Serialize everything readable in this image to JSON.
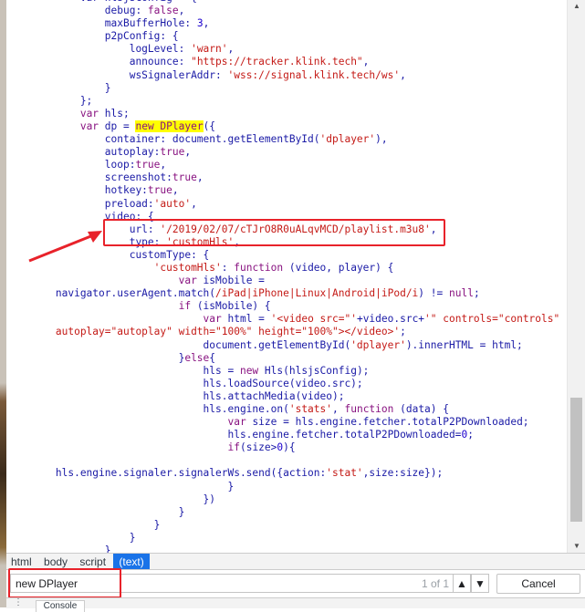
{
  "source_lines": [
    {
      "segs": [
        {
          "t": "            var hlsjsConfig = {",
          "c": "t"
        }
      ]
    },
    {
      "segs": [
        {
          "t": "                debug: ",
          "c": "t"
        },
        {
          "t": "false",
          "c": "kw"
        },
        {
          "t": ",",
          "c": "t"
        }
      ]
    },
    {
      "segs": [
        {
          "t": "                maxBufferHole: ",
          "c": "t"
        },
        {
          "t": "3",
          "c": "num"
        },
        {
          "t": ",",
          "c": "t"
        }
      ]
    },
    {
      "segs": [
        {
          "t": "                p2pConfig: {",
          "c": "t"
        }
      ]
    },
    {
      "segs": [
        {
          "t": "                    logLevel: ",
          "c": "t"
        },
        {
          "t": "'warn'",
          "c": "str"
        },
        {
          "t": ",",
          "c": "t"
        }
      ]
    },
    {
      "segs": [
        {
          "t": "                    announce: ",
          "c": "t"
        },
        {
          "t": "\"https://tracker.klink.tech\"",
          "c": "str"
        },
        {
          "t": ",",
          "c": "t"
        }
      ]
    },
    {
      "segs": [
        {
          "t": "                    wsSignalerAddr: ",
          "c": "t"
        },
        {
          "t": "'wss://signal.klink.tech/ws'",
          "c": "str"
        },
        {
          "t": ",",
          "c": "t"
        }
      ]
    },
    {
      "segs": [
        {
          "t": "                }",
          "c": "t"
        }
      ]
    },
    {
      "segs": [
        {
          "t": "            };",
          "c": "t"
        }
      ]
    },
    {
      "segs": [
        {
          "t": "            ",
          "c": "t"
        },
        {
          "t": "var",
          "c": "kw"
        },
        {
          "t": " hls;",
          "c": "t"
        }
      ]
    },
    {
      "segs": [
        {
          "t": "            ",
          "c": "t"
        },
        {
          "t": "var",
          "c": "kw"
        },
        {
          "t": " dp = ",
          "c": "t"
        },
        {
          "t": "new DPlayer",
          "c": "kw hl"
        },
        {
          "t": "({",
          "c": "t"
        }
      ]
    },
    {
      "segs": [
        {
          "t": "                container: document.getElementById(",
          "c": "t"
        },
        {
          "t": "'dplayer'",
          "c": "str"
        },
        {
          "t": "),",
          "c": "t"
        }
      ]
    },
    {
      "segs": [
        {
          "t": "                autoplay:",
          "c": "t"
        },
        {
          "t": "true",
          "c": "kw"
        },
        {
          "t": ",",
          "c": "t"
        }
      ]
    },
    {
      "segs": [
        {
          "t": "                loop:",
          "c": "t"
        },
        {
          "t": "true",
          "c": "kw"
        },
        {
          "t": ",",
          "c": "t"
        }
      ]
    },
    {
      "segs": [
        {
          "t": "                screenshot:",
          "c": "t"
        },
        {
          "t": "true",
          "c": "kw"
        },
        {
          "t": ",",
          "c": "t"
        }
      ]
    },
    {
      "segs": [
        {
          "t": "                hotkey:",
          "c": "t"
        },
        {
          "t": "true",
          "c": "kw"
        },
        {
          "t": ",",
          "c": "t"
        }
      ]
    },
    {
      "segs": [
        {
          "t": "                preload:",
          "c": "t"
        },
        {
          "t": "'auto'",
          "c": "str"
        },
        {
          "t": ",",
          "c": "t"
        }
      ]
    },
    {
      "segs": [
        {
          "t": "                video: {",
          "c": "t"
        }
      ]
    },
    {
      "segs": [
        {
          "t": "                    url: ",
          "c": "t"
        },
        {
          "t": "'/2019/02/07/cTJrO8R0uALqvMCD/playlist.m3u8'",
          "c": "str"
        },
        {
          "t": ",",
          "c": "t"
        }
      ]
    },
    {
      "segs": [
        {
          "t": "                    type: ",
          "c": "t"
        },
        {
          "t": "'customHls'",
          "c": "str"
        },
        {
          "t": ",",
          "c": "t"
        }
      ]
    },
    {
      "segs": [
        {
          "t": "                    customType: {",
          "c": "t"
        }
      ]
    },
    {
      "segs": [
        {
          "t": "                        ",
          "c": "t"
        },
        {
          "t": "'customHls'",
          "c": "str"
        },
        {
          "t": ": ",
          "c": "t"
        },
        {
          "t": "function",
          "c": "kw"
        },
        {
          "t": " (video, player) {",
          "c": "t"
        }
      ]
    },
    {
      "segs": [
        {
          "t": "                            ",
          "c": "t"
        },
        {
          "t": "var",
          "c": "kw"
        },
        {
          "t": " isMobile =",
          "c": "t"
        }
      ]
    },
    {
      "segs": [
        {
          "t": "        navigator.userAgent.match(",
          "c": "t"
        },
        {
          "t": "/iPad|iPhone|Linux|Android|iPod/i",
          "c": "str"
        },
        {
          "t": ") != ",
          "c": "t"
        },
        {
          "t": "null",
          "c": "kw"
        },
        {
          "t": ";",
          "c": "t"
        }
      ]
    },
    {
      "segs": [
        {
          "t": "                            ",
          "c": "t"
        },
        {
          "t": "if",
          "c": "kw"
        },
        {
          "t": " (isMobile) {",
          "c": "t"
        }
      ]
    },
    {
      "segs": [
        {
          "t": "                                ",
          "c": "t"
        },
        {
          "t": "var",
          "c": "kw"
        },
        {
          "t": " html = ",
          "c": "t"
        },
        {
          "t": "'<video src=\"'",
          "c": "str"
        },
        {
          "t": "+video.src+",
          "c": "t"
        },
        {
          "t": "'\" controls=\"controls\"",
          "c": "str"
        }
      ]
    },
    {
      "segs": [
        {
          "t": "        autoplay=\"autoplay\" width=\"100%\" height=\"100%\"></video>'",
          "c": "str"
        },
        {
          "t": ";",
          "c": "t"
        }
      ]
    },
    {
      "segs": [
        {
          "t": "                                document.getElementById(",
          "c": "t"
        },
        {
          "t": "'dplayer'",
          "c": "str"
        },
        {
          "t": ").innerHTML = html;",
          "c": "t"
        }
      ]
    },
    {
      "segs": [
        {
          "t": "                            }",
          "c": "t"
        },
        {
          "t": "else",
          "c": "kw"
        },
        {
          "t": "{",
          "c": "t"
        }
      ]
    },
    {
      "segs": [
        {
          "t": "                                hls = ",
          "c": "t"
        },
        {
          "t": "new",
          "c": "kw"
        },
        {
          "t": " Hls(hlsjsConfig);",
          "c": "t"
        }
      ]
    },
    {
      "segs": [
        {
          "t": "                                hls.loadSource(video.src);",
          "c": "t"
        }
      ]
    },
    {
      "segs": [
        {
          "t": "                                hls.attachMedia(video);",
          "c": "t"
        }
      ]
    },
    {
      "segs": [
        {
          "t": "                                hls.engine.on(",
          "c": "t"
        },
        {
          "t": "'stats'",
          "c": "str"
        },
        {
          "t": ", ",
          "c": "t"
        },
        {
          "t": "function",
          "c": "kw"
        },
        {
          "t": " (data) {",
          "c": "t"
        }
      ]
    },
    {
      "segs": [
        {
          "t": "                                    ",
          "c": "t"
        },
        {
          "t": "var",
          "c": "kw"
        },
        {
          "t": " size = hls.engine.fetcher.totalP2PDownloaded;",
          "c": "t"
        }
      ]
    },
    {
      "segs": [
        {
          "t": "                                    hls.engine.fetcher.totalP2PDownloaded=",
          "c": "t"
        },
        {
          "t": "0",
          "c": "num"
        },
        {
          "t": ";",
          "c": "t"
        }
      ]
    },
    {
      "segs": [
        {
          "t": "                                    ",
          "c": "t"
        },
        {
          "t": "if",
          "c": "kw"
        },
        {
          "t": "(size>",
          "c": "t"
        },
        {
          "t": "0",
          "c": "num"
        },
        {
          "t": "){",
          "c": "t"
        }
      ]
    },
    {
      "segs": [
        {
          "t": "",
          "c": "t"
        }
      ]
    },
    {
      "segs": [
        {
          "t": "        hls.engine.signaler.signalerWs.send({action:",
          "c": "t"
        },
        {
          "t": "'stat'",
          "c": "str"
        },
        {
          "t": ",size:size});",
          "c": "t"
        }
      ]
    },
    {
      "segs": [
        {
          "t": "                                    }",
          "c": "t"
        }
      ]
    },
    {
      "segs": [
        {
          "t": "                                })",
          "c": "t"
        }
      ]
    },
    {
      "segs": [
        {
          "t": "                            }",
          "c": "t"
        }
      ]
    },
    {
      "segs": [
        {
          "t": "                        }",
          "c": "t"
        }
      ]
    },
    {
      "segs": [
        {
          "t": "                    }",
          "c": "t"
        }
      ]
    },
    {
      "segs": [
        {
          "t": "                }",
          "c": "t"
        }
      ]
    }
  ],
  "breadcrumb": {
    "items": [
      "html",
      "body",
      "script"
    ],
    "active": "(text)"
  },
  "find": {
    "query": "new DPlayer",
    "count": "1 of 1",
    "prev_icon": "▲",
    "next_icon": "▼",
    "cancel_label": "Cancel"
  },
  "bottom": {
    "menu_icon": "⋮",
    "tab_label": "Console"
  },
  "colors": {
    "annotation_red": "#e8222a",
    "search_highlight": "#ffff00",
    "active_crumb": "#1a73e8"
  }
}
